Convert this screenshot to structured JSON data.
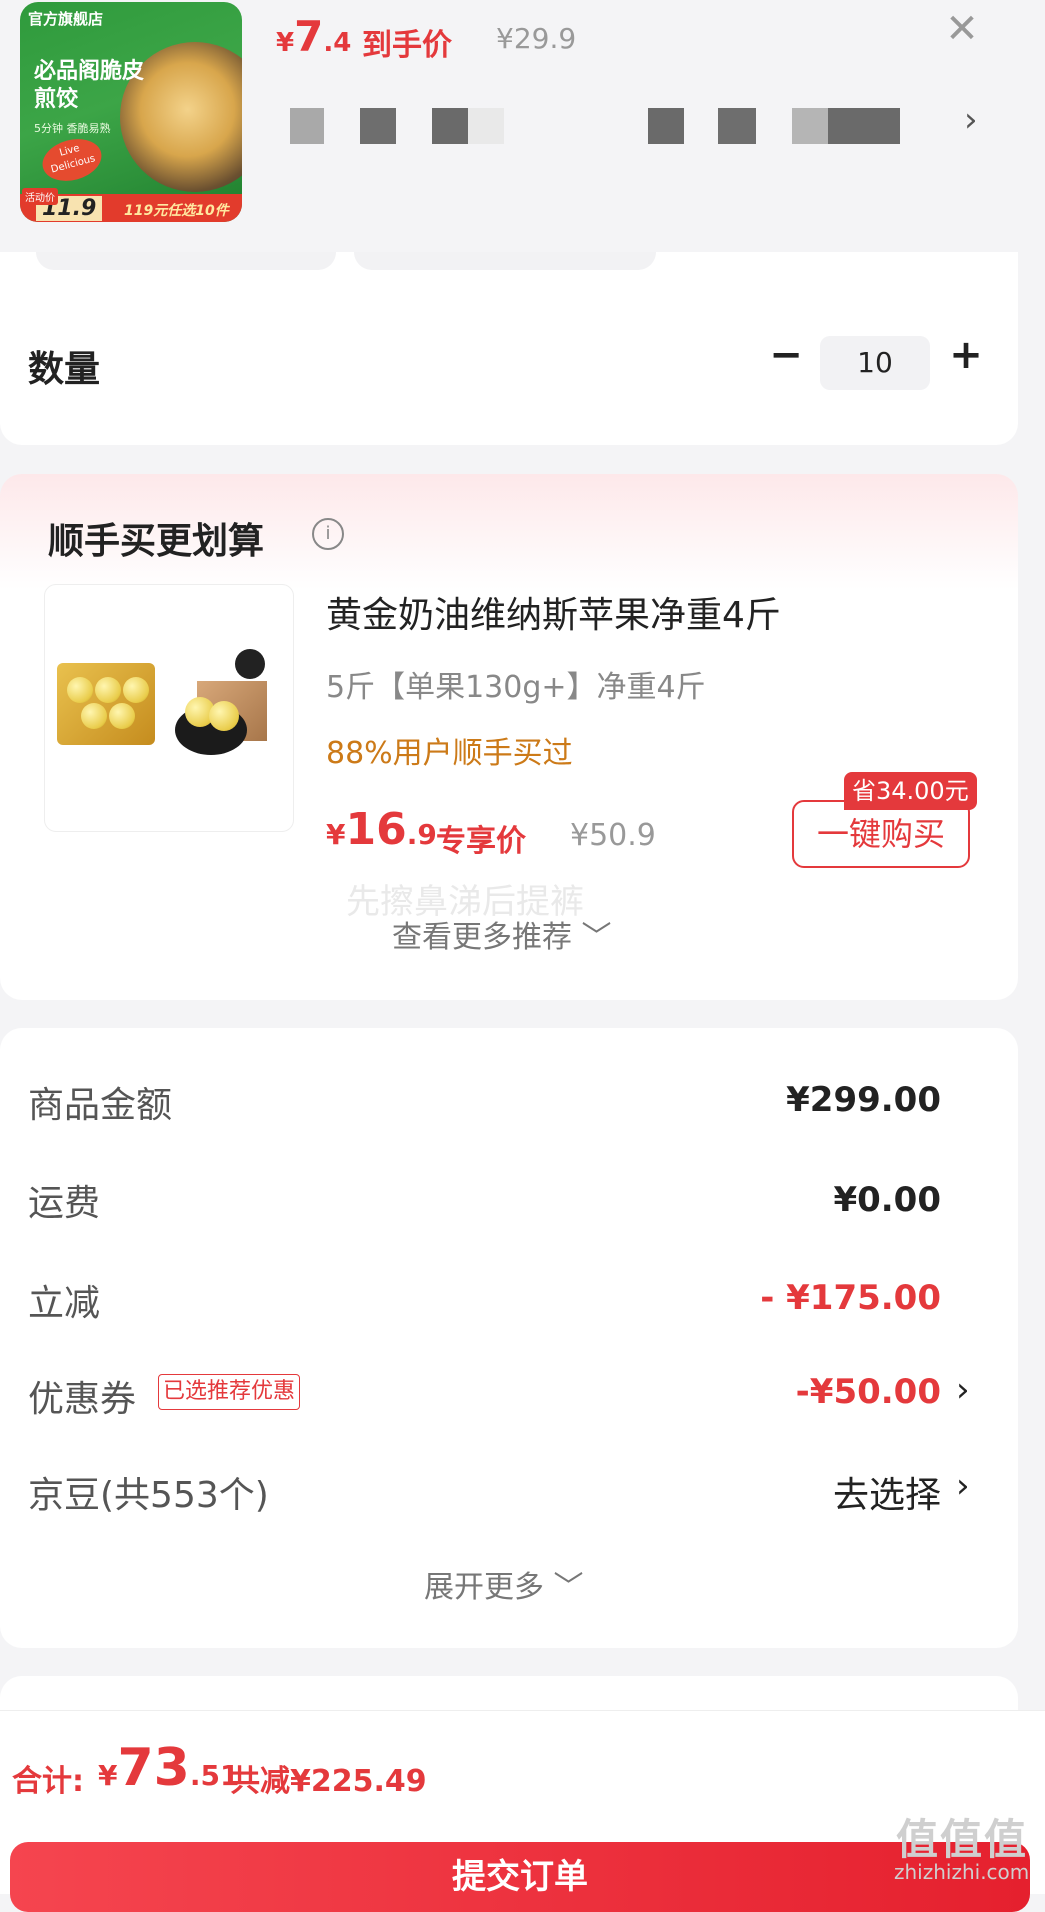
{
  "product": {
    "thumb": {
      "store": "官方旗舰店",
      "name": "必品阁脆皮煎饺",
      "sub": "5分钟 香脆易熟",
      "live": "Live Delicious",
      "activity": "活动价",
      "promo_price": "11.9",
      "promo_text": "119元任选10件"
    },
    "price": {
      "yen": "¥",
      "int": "7",
      "dec": ".4"
    },
    "price_label": "到手价",
    "orig_price": "¥29.9",
    "close": "✕",
    "next_arrow": "›"
  },
  "quantity": {
    "label": "数量",
    "minus": "−",
    "value": "10",
    "plus": "+"
  },
  "recommend": {
    "title": "顺手买更划算",
    "info_icon": "i",
    "item": {
      "name": "黄金奶油维纳斯苹果净重4斤",
      "spec": "5斤【单果130g+】净重4斤",
      "hint": "88%用户顺手买过",
      "price": {
        "yen": "¥",
        "int": "16",
        "dec": ".9"
      },
      "price_label": "专享价",
      "orig_price": "¥50.9",
      "save_tag": "省34.00元",
      "buy_label": "一键购买"
    },
    "ghost_text": "先擦鼻涕后提裤",
    "more": "查看更多推荐 ﹀"
  },
  "summary": {
    "goods_label": "商品金额",
    "goods_value": "¥299.00",
    "shipping_label": "运费",
    "shipping_value": "¥0.00",
    "discount_label": "立减",
    "discount_value": "- ¥175.00",
    "coupon_label": "优惠券",
    "coupon_tag": "已选推荐优惠",
    "coupon_value": "-¥50.00",
    "bean_label": "京豆(共553个)",
    "bean_value": "去选择",
    "arrow": "›",
    "more": "展开更多 ﹀"
  },
  "footer": {
    "total_label": "合计:",
    "total": {
      "yen": "¥",
      "int": "73",
      "dec": ".51"
    },
    "total_discount": "共减¥225.49",
    "submit": "提交订单",
    "watermark": "值值值",
    "watermark_url": "zhizhizhi.com"
  },
  "colors": {
    "accent": "#e4393c",
    "hint": "#cc7a18",
    "background": "#f4f4f6"
  }
}
